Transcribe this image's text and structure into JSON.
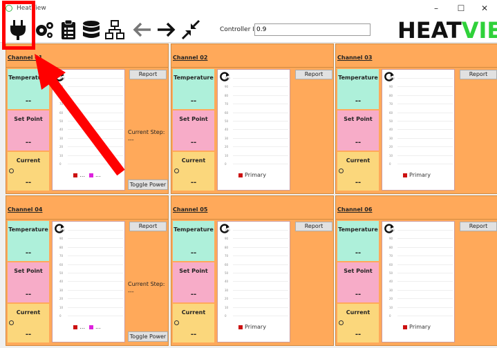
{
  "window": {
    "title": "HeatView",
    "minimize": "–",
    "maximize": "☐",
    "close": "✕"
  },
  "toolbar": {
    "icons": [
      "plug-icon",
      "gears-icon",
      "clipboard-icon",
      "database-icon",
      "network-icon",
      "arrow-left-icon",
      "arrow-right-icon",
      "compress-icon"
    ],
    "controller_label": "Controller ID:",
    "controller_value": "0.9",
    "logo_heat": "HEAT",
    "logo_view": "VIEW"
  },
  "colors": {
    "panel": "#ffa95a",
    "temperature": "#aef0da",
    "setpoint": "#f7acc8",
    "current": "#fbd77c",
    "highlight": "#ff0000",
    "logo_green": "#2fd13a"
  },
  "channels": [
    {
      "title": "Channel 01",
      "temp_label": "Temperature",
      "temp_val": "--",
      "set_label": "Set Point",
      "set_val": "--",
      "cur_label": "Current",
      "cur_val": "--",
      "report": "Report",
      "current_step_label": "Current Step:",
      "current_step_val": "---",
      "toggle": "Toggle Power",
      "legend": [
        "...",
        "..."
      ],
      "multi": true
    },
    {
      "title": "Channel 02",
      "temp_label": "Temperature",
      "temp_val": "--",
      "set_label": "Set Point",
      "set_val": "--",
      "cur_label": "Current",
      "cur_val": "--",
      "report": "Report",
      "legend": [
        "Primary"
      ],
      "multi": false
    },
    {
      "title": "Channel 03",
      "temp_label": "Temperature",
      "temp_val": "--",
      "set_label": "Set Point",
      "set_val": "--",
      "cur_label": "Current",
      "cur_val": "--",
      "report": "Report",
      "legend": [
        "Primary"
      ],
      "multi": false
    },
    {
      "title": "Channel 04",
      "temp_label": "Temperature",
      "temp_val": "--",
      "set_label": "Set Point",
      "set_val": "--",
      "cur_label": "Current",
      "cur_val": "--",
      "report": "Report",
      "current_step_label": "Current Step:",
      "current_step_val": "---",
      "toggle": "Toggle Power",
      "legend": [
        "...",
        "..."
      ],
      "multi": true
    },
    {
      "title": "Channel 05",
      "temp_label": "Temperature",
      "temp_val": "--",
      "set_label": "Set Point",
      "set_val": "--",
      "cur_label": "Current",
      "cur_val": "--",
      "report": "Report",
      "legend": [
        "Primary"
      ],
      "multi": false
    },
    {
      "title": "Channel 06",
      "temp_label": "Temperature",
      "temp_val": "--",
      "set_label": "Set Point",
      "set_val": "--",
      "cur_label": "Current",
      "cur_val": "--",
      "report": "Report",
      "legend": [
        "Primary"
      ],
      "multi": false
    }
  ],
  "chart_ticks": [
    "100",
    "90",
    "80",
    "70",
    "60",
    "50",
    "40",
    "30",
    "20",
    "10",
    "0"
  ]
}
